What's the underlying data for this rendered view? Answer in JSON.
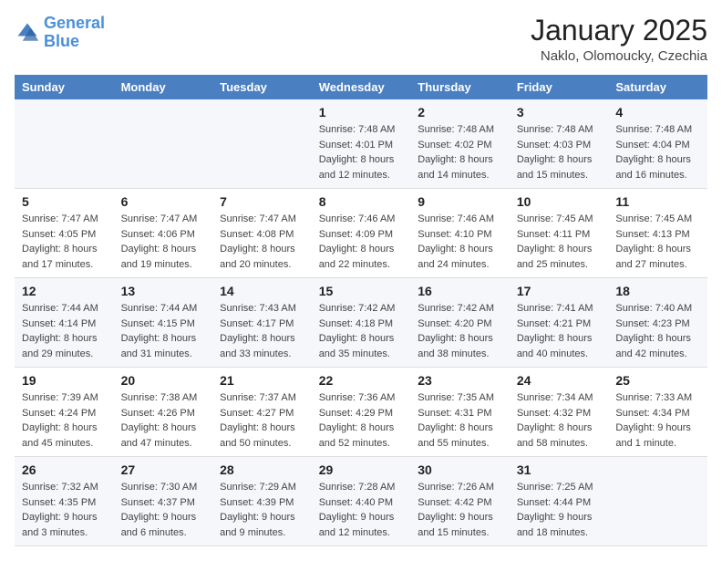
{
  "header": {
    "logo_line1": "General",
    "logo_line2": "Blue",
    "month_title": "January 2025",
    "location": "Naklo, Olomoucky, Czechia"
  },
  "days_of_week": [
    "Sunday",
    "Monday",
    "Tuesday",
    "Wednesday",
    "Thursday",
    "Friday",
    "Saturday"
  ],
  "weeks": [
    [
      {
        "num": "",
        "info": ""
      },
      {
        "num": "",
        "info": ""
      },
      {
        "num": "",
        "info": ""
      },
      {
        "num": "1",
        "info": "Sunrise: 7:48 AM\nSunset: 4:01 PM\nDaylight: 8 hours and 12 minutes."
      },
      {
        "num": "2",
        "info": "Sunrise: 7:48 AM\nSunset: 4:02 PM\nDaylight: 8 hours and 14 minutes."
      },
      {
        "num": "3",
        "info": "Sunrise: 7:48 AM\nSunset: 4:03 PM\nDaylight: 8 hours and 15 minutes."
      },
      {
        "num": "4",
        "info": "Sunrise: 7:48 AM\nSunset: 4:04 PM\nDaylight: 8 hours and 16 minutes."
      }
    ],
    [
      {
        "num": "5",
        "info": "Sunrise: 7:47 AM\nSunset: 4:05 PM\nDaylight: 8 hours and 17 minutes."
      },
      {
        "num": "6",
        "info": "Sunrise: 7:47 AM\nSunset: 4:06 PM\nDaylight: 8 hours and 19 minutes."
      },
      {
        "num": "7",
        "info": "Sunrise: 7:47 AM\nSunset: 4:08 PM\nDaylight: 8 hours and 20 minutes."
      },
      {
        "num": "8",
        "info": "Sunrise: 7:46 AM\nSunset: 4:09 PM\nDaylight: 8 hours and 22 minutes."
      },
      {
        "num": "9",
        "info": "Sunrise: 7:46 AM\nSunset: 4:10 PM\nDaylight: 8 hours and 24 minutes."
      },
      {
        "num": "10",
        "info": "Sunrise: 7:45 AM\nSunset: 4:11 PM\nDaylight: 8 hours and 25 minutes."
      },
      {
        "num": "11",
        "info": "Sunrise: 7:45 AM\nSunset: 4:13 PM\nDaylight: 8 hours and 27 minutes."
      }
    ],
    [
      {
        "num": "12",
        "info": "Sunrise: 7:44 AM\nSunset: 4:14 PM\nDaylight: 8 hours and 29 minutes."
      },
      {
        "num": "13",
        "info": "Sunrise: 7:44 AM\nSunset: 4:15 PM\nDaylight: 8 hours and 31 minutes."
      },
      {
        "num": "14",
        "info": "Sunrise: 7:43 AM\nSunset: 4:17 PM\nDaylight: 8 hours and 33 minutes."
      },
      {
        "num": "15",
        "info": "Sunrise: 7:42 AM\nSunset: 4:18 PM\nDaylight: 8 hours and 35 minutes."
      },
      {
        "num": "16",
        "info": "Sunrise: 7:42 AM\nSunset: 4:20 PM\nDaylight: 8 hours and 38 minutes."
      },
      {
        "num": "17",
        "info": "Sunrise: 7:41 AM\nSunset: 4:21 PM\nDaylight: 8 hours and 40 minutes."
      },
      {
        "num": "18",
        "info": "Sunrise: 7:40 AM\nSunset: 4:23 PM\nDaylight: 8 hours and 42 minutes."
      }
    ],
    [
      {
        "num": "19",
        "info": "Sunrise: 7:39 AM\nSunset: 4:24 PM\nDaylight: 8 hours and 45 minutes."
      },
      {
        "num": "20",
        "info": "Sunrise: 7:38 AM\nSunset: 4:26 PM\nDaylight: 8 hours and 47 minutes."
      },
      {
        "num": "21",
        "info": "Sunrise: 7:37 AM\nSunset: 4:27 PM\nDaylight: 8 hours and 50 minutes."
      },
      {
        "num": "22",
        "info": "Sunrise: 7:36 AM\nSunset: 4:29 PM\nDaylight: 8 hours and 52 minutes."
      },
      {
        "num": "23",
        "info": "Sunrise: 7:35 AM\nSunset: 4:31 PM\nDaylight: 8 hours and 55 minutes."
      },
      {
        "num": "24",
        "info": "Sunrise: 7:34 AM\nSunset: 4:32 PM\nDaylight: 8 hours and 58 minutes."
      },
      {
        "num": "25",
        "info": "Sunrise: 7:33 AM\nSunset: 4:34 PM\nDaylight: 9 hours and 1 minute."
      }
    ],
    [
      {
        "num": "26",
        "info": "Sunrise: 7:32 AM\nSunset: 4:35 PM\nDaylight: 9 hours and 3 minutes."
      },
      {
        "num": "27",
        "info": "Sunrise: 7:30 AM\nSunset: 4:37 PM\nDaylight: 9 hours and 6 minutes."
      },
      {
        "num": "28",
        "info": "Sunrise: 7:29 AM\nSunset: 4:39 PM\nDaylight: 9 hours and 9 minutes."
      },
      {
        "num": "29",
        "info": "Sunrise: 7:28 AM\nSunset: 4:40 PM\nDaylight: 9 hours and 12 minutes."
      },
      {
        "num": "30",
        "info": "Sunrise: 7:26 AM\nSunset: 4:42 PM\nDaylight: 9 hours and 15 minutes."
      },
      {
        "num": "31",
        "info": "Sunrise: 7:25 AM\nSunset: 4:44 PM\nDaylight: 9 hours and 18 minutes."
      },
      {
        "num": "",
        "info": ""
      }
    ]
  ]
}
